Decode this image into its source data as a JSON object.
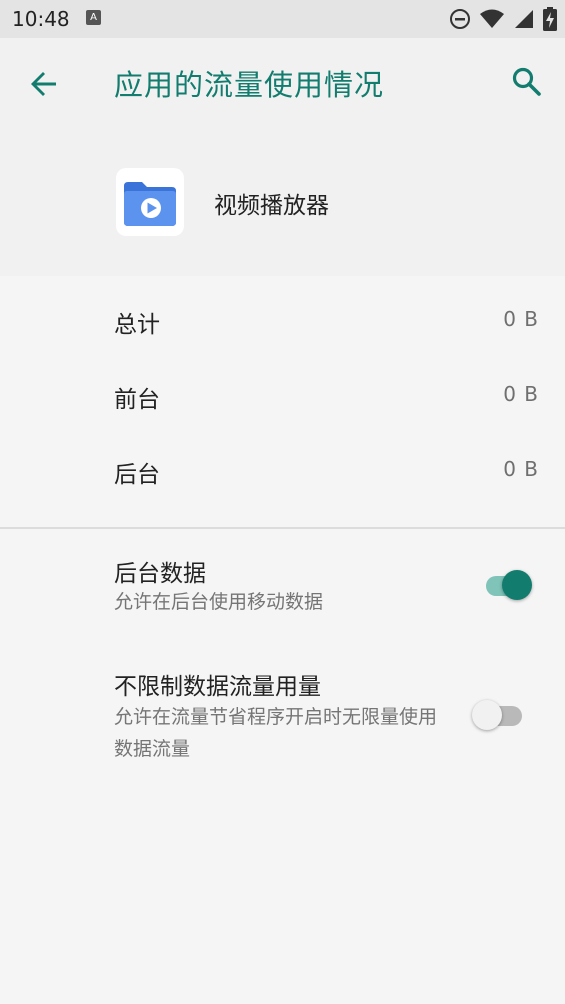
{
  "status_bar": {
    "time": "10:48",
    "notif_glyph": "A",
    "icons": [
      "dnd-icon",
      "wifi-icon",
      "signal-icon",
      "battery-icon"
    ]
  },
  "app_bar": {
    "title": "应用的流量使用情况"
  },
  "app": {
    "name": "视频播放器"
  },
  "usage": {
    "total": {
      "label": "总计",
      "value": "0 B"
    },
    "foreground": {
      "label": "前台",
      "value": "0 B"
    },
    "background": {
      "label": "后台",
      "value": "0 B"
    }
  },
  "settings": {
    "background_data": {
      "title": "后台数据",
      "subtitle": "允许在后台使用移动数据",
      "enabled": true
    },
    "unrestricted_data": {
      "title": "不限制数据流量用量",
      "subtitle": "允许在流量节省程序开启时无限量使用数据流量",
      "enabled": false
    }
  },
  "colors": {
    "accent": "#127d6f",
    "switch_on_track": "#7fc3b9",
    "switch_off_track": "#b9b9b9",
    "switch_off_thumb": "#f1f1f1"
  }
}
